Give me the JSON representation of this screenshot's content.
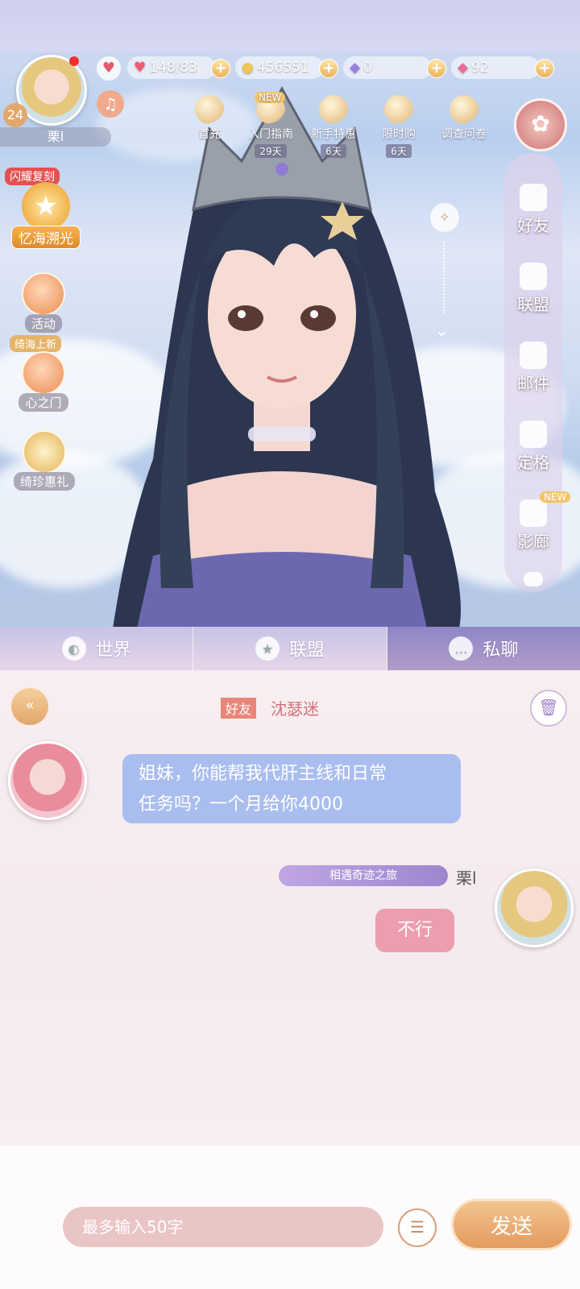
{
  "player": {
    "level": "24",
    "name": "栗l"
  },
  "currencies": {
    "stamina": "148/83",
    "coins": "456551",
    "gems": "0",
    "diamonds": "92"
  },
  "top_menu": [
    {
      "label": "首充",
      "badge": "",
      "days": ""
    },
    {
      "label": "入门指南",
      "badge": "NEW",
      "days": "29天"
    },
    {
      "label": "新手特惠",
      "badge": "",
      "days": "6天"
    },
    {
      "label": "限时购",
      "badge": "",
      "days": "6天"
    },
    {
      "label": "调查问卷",
      "badge": "",
      "days": ""
    }
  ],
  "left_menu": {
    "event_tag": "闪耀复刻",
    "event_label": "忆海溯光",
    "activity": "活动",
    "new_tag": "绮海上新",
    "heart_door": "心之门",
    "gifts": "绮珍惠礼"
  },
  "right_rail": [
    {
      "label": "好友",
      "icon": "friend-icon"
    },
    {
      "label": "联盟",
      "icon": "alliance-icon"
    },
    {
      "label": "邮件",
      "icon": "mail-icon"
    },
    {
      "label": "定格",
      "icon": "home-icon"
    },
    {
      "label": "影廊",
      "icon": "camera-icon",
      "badge": "NEW"
    }
  ],
  "tabs": [
    {
      "label": "世界",
      "icon": "globe-icon"
    },
    {
      "label": "联盟",
      "icon": "shield-star-icon"
    },
    {
      "label": "私聊",
      "icon": "chat-bubble-icon"
    }
  ],
  "chat": {
    "relation_tag": "好友",
    "partner_name": "沈瑟迷",
    "messages": [
      {
        "from": "other",
        "text_line1": "姐妹，你能帮我代肝主线和日常",
        "text_line2": "任务吗？一个月给你4000"
      },
      {
        "from": "me",
        "title_badge": "相遇奇迹之旅",
        "name": "栗l",
        "text": "不行"
      }
    ]
  },
  "input": {
    "placeholder": "最多输入50字",
    "send_label": "发送"
  },
  "colors": {
    "accent": "#e9a96d",
    "bubble_other": "#a9bdef",
    "bubble_me": "#ec9eae",
    "tab_active": "#8f86c7"
  }
}
